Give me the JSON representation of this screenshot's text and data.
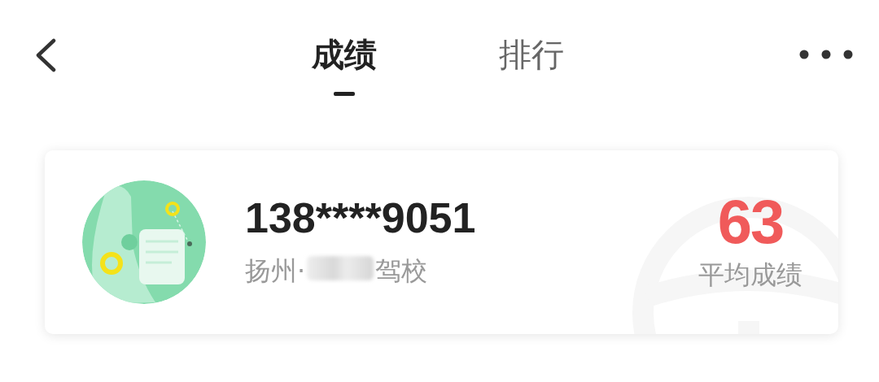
{
  "header": {
    "tabs": [
      {
        "label": "成绩",
        "selected": true
      },
      {
        "label": "排行",
        "selected": false
      }
    ]
  },
  "card": {
    "phone": "138****9051",
    "school": {
      "prefix": "扬州·",
      "redacted": true,
      "suffix": "驾校"
    },
    "score": "63",
    "score_label": "平均成绩"
  }
}
